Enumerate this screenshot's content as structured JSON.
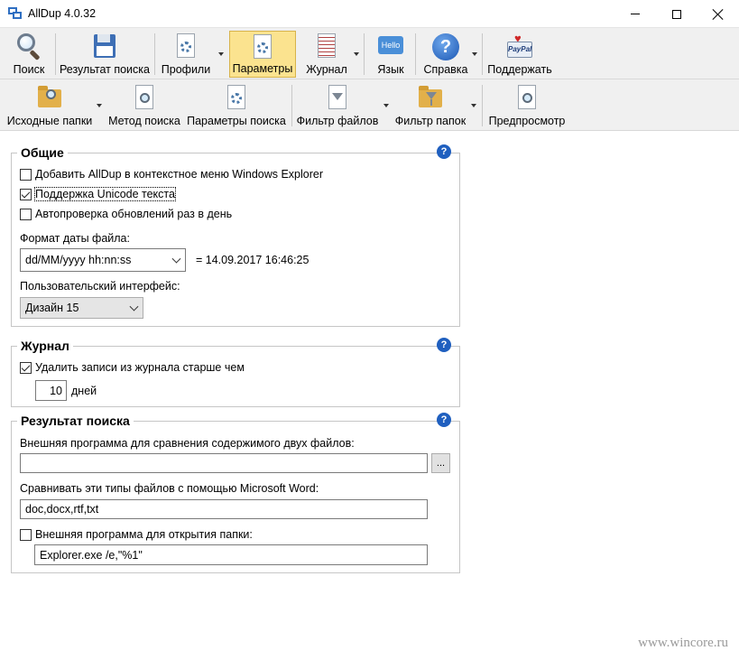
{
  "window": {
    "title": "AllDup 4.0.32"
  },
  "toolbar_main": [
    {
      "label": "Поиск",
      "icon": "search-magnifier-icon"
    },
    {
      "label": "Результат поиска",
      "icon": "save-disk-icon"
    },
    {
      "label": "Профили",
      "icon": "profile-gear-icon"
    },
    {
      "label": "Параметры",
      "icon": "settings-gear-icon",
      "active": true
    },
    {
      "label": "Журнал",
      "icon": "journal-icon"
    },
    {
      "label": "Язык",
      "icon": "hello-language-icon"
    },
    {
      "label": "Справка",
      "icon": "help-icon"
    },
    {
      "label": "Поддержать",
      "icon": "paypal-icon"
    }
  ],
  "toolbar_sub": [
    {
      "label": "Исходные папки",
      "icon": "folder-search-icon"
    },
    {
      "label": "Метод поиска",
      "icon": "search-method-icon"
    },
    {
      "label": "Параметры поиска",
      "icon": "search-options-icon"
    },
    {
      "label": "Фильтр файлов",
      "icon": "file-filter-icon"
    },
    {
      "label": "Фильтр папок",
      "icon": "folder-filter-icon"
    },
    {
      "label": "Предпросмотр",
      "icon": "preview-icon"
    }
  ],
  "general": {
    "title": "Общие",
    "help": "?",
    "opt_context_menu": {
      "label": "Добавить AllDup в контекстное меню Windows Explorer",
      "checked": false
    },
    "opt_unicode": {
      "label": "Поддержка Unicode текста",
      "checked": true
    },
    "opt_autoupdate": {
      "label": "Автопроверка обновлений раз в день",
      "checked": false
    },
    "date_format_label": "Формат даты файла:",
    "date_format_value": "dd/MM/yyyy hh:nn:ss",
    "date_preview": "= 14.09.2017 16:46:25",
    "ui_label": "Пользовательский интерфейс:",
    "ui_value": "Дизайн 15"
  },
  "journal": {
    "title": "Журнал",
    "help": "?",
    "opt_delete_old": {
      "label": "Удалить записи из журнала старше чем",
      "checked": true
    },
    "days_value": "10",
    "days_unit": "дней"
  },
  "results": {
    "title": "Результат поиска",
    "help": "?",
    "compare_label": "Внешняя программа для сравнения содержимого двух файлов:",
    "compare_value": "",
    "browse_label": "...",
    "word_label": "Сравнивать эти типы файлов с помощью Microsoft Word:",
    "word_value": "doc,docx,rtf,txt",
    "opt_open_folder": {
      "label": "Внешняя программа для открытия папки:",
      "checked": false
    },
    "open_folder_value": "Explorer.exe /e,\"%1\""
  },
  "watermark": "www.wincore.ru"
}
